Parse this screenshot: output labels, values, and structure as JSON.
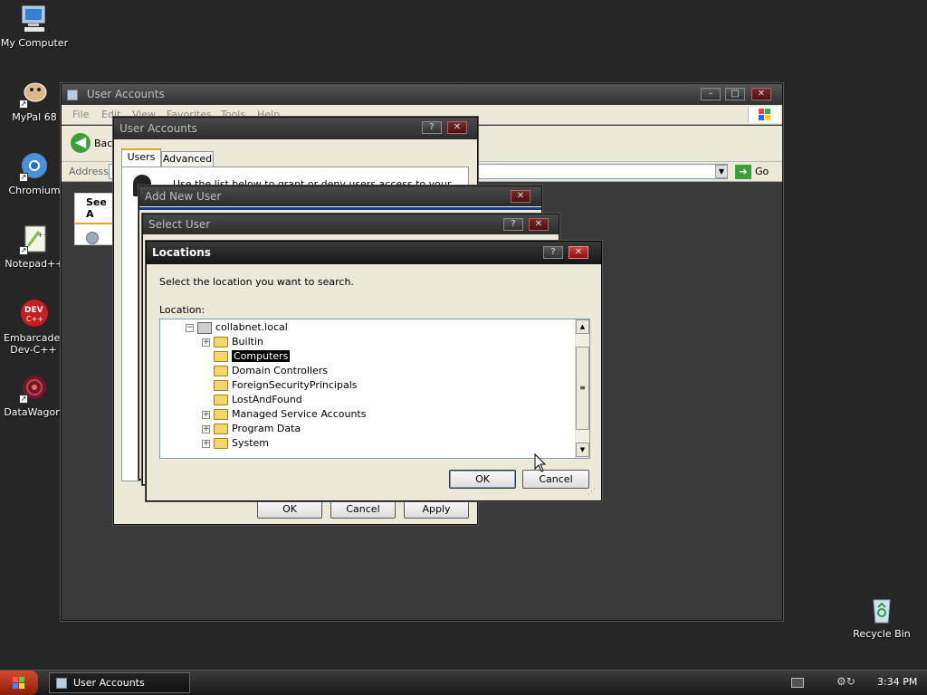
{
  "desktop": {
    "icons": [
      {
        "label": "My Computer"
      },
      {
        "label": "MyPal 68"
      },
      {
        "label": "Chromium"
      },
      {
        "label": "Notepad++"
      },
      {
        "label": "Embarcadero Dev-C++"
      },
      {
        "label": "DataWagon."
      },
      {
        "label": "Recycle Bin"
      }
    ]
  },
  "explorer": {
    "title": "User Accounts",
    "menu": [
      "File",
      "Edit",
      "View",
      "Favorites",
      "Tools",
      "Help"
    ],
    "back_label": "Back",
    "address_label": "Address",
    "go_label": "Go",
    "see_also": "See A"
  },
  "user_accounts_dialog": {
    "title": "User Accounts",
    "tabs": [
      "Users",
      "Advanced"
    ],
    "intro": "Use the list below to grant or deny users access to your",
    "ok": "OK",
    "cancel": "Cancel",
    "apply": "Apply"
  },
  "add_new_user": {
    "title": "Add New User"
  },
  "select_user": {
    "title": "Select User"
  },
  "locations": {
    "title": "Locations",
    "instruction": "Select the location you want to search.",
    "location_label": "Location:",
    "root": "collabnet.local",
    "items": [
      {
        "label": "Builtin",
        "expandable": true,
        "selected": false
      },
      {
        "label": "Computers",
        "expandable": false,
        "selected": true
      },
      {
        "label": "Domain Controllers",
        "expandable": false,
        "selected": false
      },
      {
        "label": "ForeignSecurityPrincipals",
        "expandable": false,
        "selected": false
      },
      {
        "label": "LostAndFound",
        "expandable": false,
        "selected": false
      },
      {
        "label": "Managed Service Accounts",
        "expandable": true,
        "selected": false
      },
      {
        "label": "Program Data",
        "expandable": true,
        "selected": false
      },
      {
        "label": "System",
        "expandable": true,
        "selected": false
      }
    ],
    "ok": "OK",
    "cancel": "Cancel"
  },
  "taskbar": {
    "task": "User Accounts",
    "clock": "3:34 PM"
  }
}
